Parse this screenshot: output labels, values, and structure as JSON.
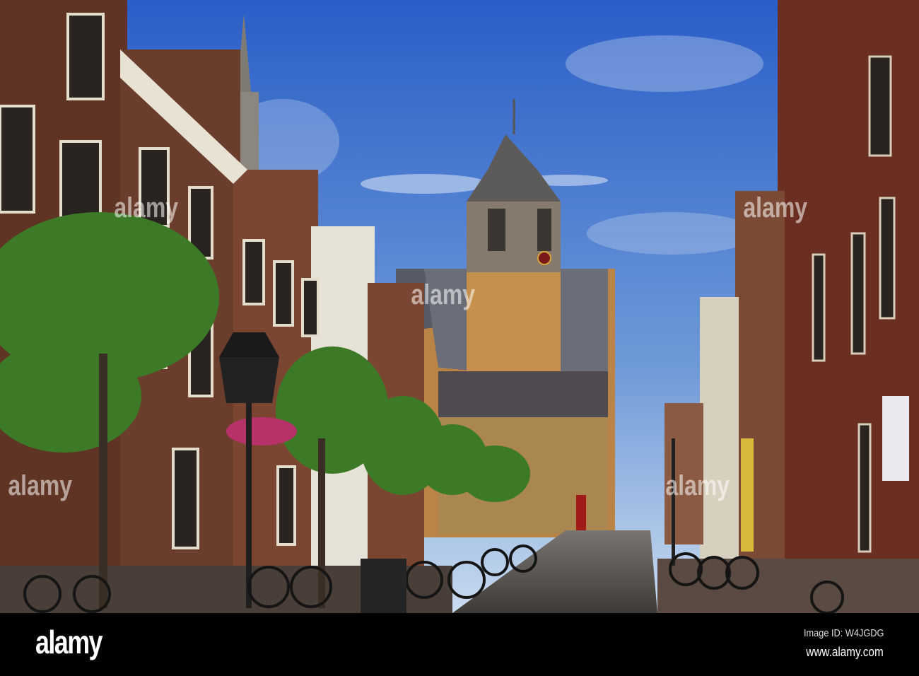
{
  "watermark": {
    "text": "alamy"
  },
  "footer": {
    "logo": "alamy",
    "image_id": "Image ID: W4JGDG",
    "url": "www.alamy.com"
  },
  "colors": {
    "sky_top": "#2f63c9",
    "sky_bottom": "#a9c6e8",
    "brick": "#6b3a28",
    "church": "#c08a4a",
    "tree": "#3f7a2a"
  }
}
